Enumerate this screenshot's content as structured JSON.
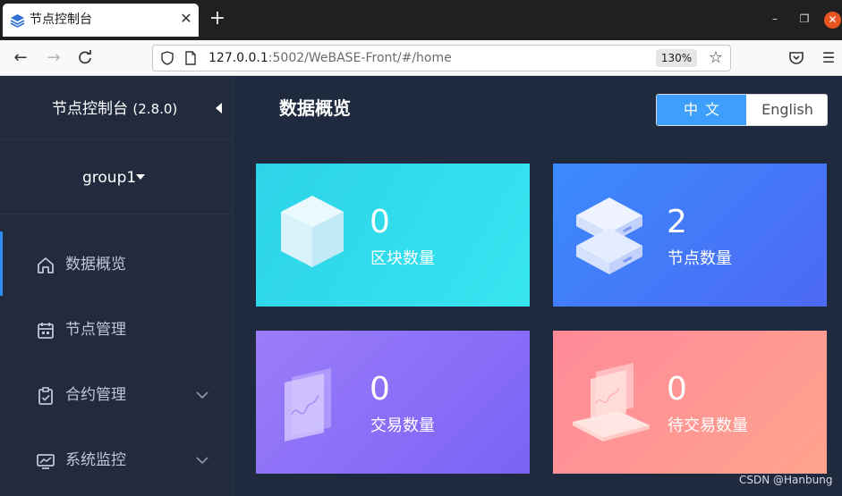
{
  "browser": {
    "tab_title": "节点控制台",
    "url_host": "127.0.0.1",
    "url_rest": ":5002/WeBASE-Front/#/home",
    "zoom": "130%",
    "new_tab_symbol": "+",
    "close_symbol": "✕"
  },
  "sidebar": {
    "title": "节点控制台",
    "version": "(2.8.0)",
    "group": "group1",
    "items": [
      {
        "label": "数据概览",
        "icon": "home-icon",
        "active": true
      },
      {
        "label": "节点管理",
        "icon": "calendar-icon",
        "active": false
      },
      {
        "label": "合约管理",
        "icon": "clipboard-icon",
        "active": false,
        "expandable": true
      },
      {
        "label": "系统监控",
        "icon": "monitor-icon",
        "active": false,
        "expandable": true
      }
    ]
  },
  "main": {
    "title": "数据概览",
    "lang": {
      "zh": "中文",
      "en": "English",
      "selected": "zh"
    },
    "cards": [
      {
        "value": "0",
        "label": "区块数量",
        "icon": "cube-icon"
      },
      {
        "value": "2",
        "label": "节点数量",
        "icon": "server-icon"
      },
      {
        "value": "0",
        "label": "交易数量",
        "icon": "chart-pane-icon"
      },
      {
        "value": "0",
        "label": "待交易数量",
        "icon": "laptop-icon"
      }
    ]
  },
  "watermark": "CSDN @Hanbung",
  "colors": {
    "accent": "#3e9efb",
    "sidebar_bg": "#212b3d",
    "main_bg": "#1f2a3e",
    "card_blocks": "#2dd3e8",
    "card_nodes": "#3b8afd",
    "card_tx": "#8a6ff7",
    "card_pending": "#ff8e98"
  }
}
